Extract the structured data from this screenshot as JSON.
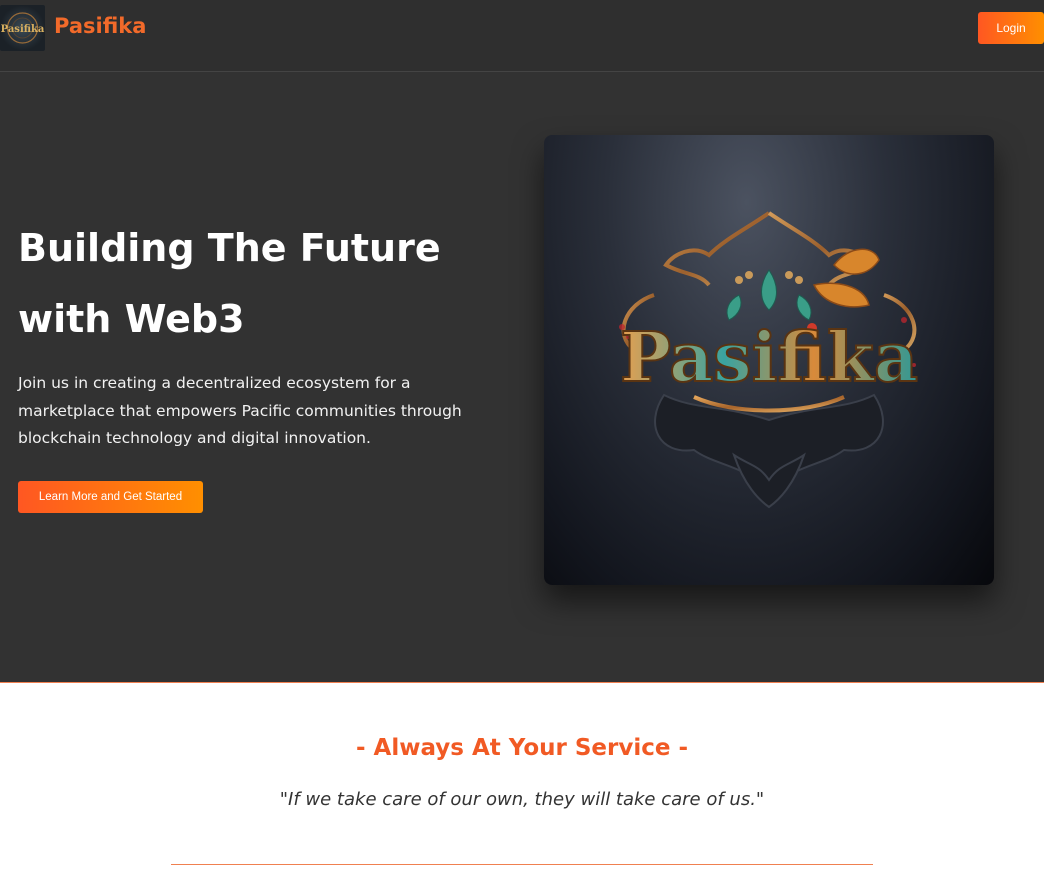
{
  "header": {
    "brand": "Pasifika",
    "login_label": "Login",
    "logo_text": "Pasifika"
  },
  "hero": {
    "title": "Building The Future with Web3",
    "subtitle": "Join us in creating a decentralized ecosystem for a marketplace that empowers Pacific communities through blockchain technology and digital innovation.",
    "cta_label": "Learn More and Get Started",
    "image_text": "Pasifika"
  },
  "service": {
    "title": "- Always At Your Service -",
    "quote": "\"If we take care of our own, they will take care of us.\""
  },
  "colors": {
    "accent": "#f15a24",
    "accent_gradient_end": "#ff8f00",
    "header_bg": "#2f2f2f",
    "hero_bg": "#323232"
  }
}
